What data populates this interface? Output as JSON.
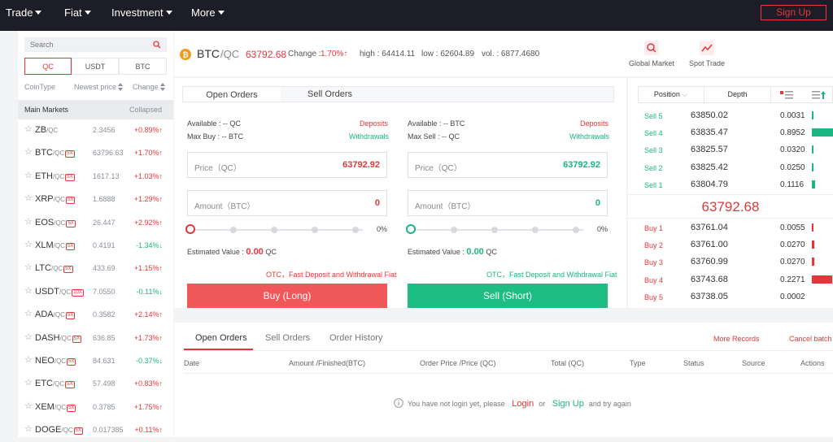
{
  "nav": {
    "items": [
      "Trade",
      "Fiat",
      "Investment",
      "More"
    ],
    "signup": "Sign Up"
  },
  "sidebar": {
    "search_placeholder": "Search",
    "quote_tabs": [
      "QC",
      "USDT",
      "BTC"
    ],
    "columns": {
      "coin": "CoinType",
      "price": "Newest price",
      "change": "Change"
    },
    "markets_label": "Main Markets",
    "collapsed_label": "Collapsed",
    "markets": [
      {
        "coin": "ZB",
        "quote": "/QC",
        "lev": "",
        "price": "2.3456",
        "change": "+0.89%",
        "dir": "up"
      },
      {
        "coin": "BTC",
        "quote": "/QC",
        "lev": "5X",
        "price": "63796.63",
        "change": "+1.70%",
        "dir": "up"
      },
      {
        "coin": "ETH",
        "quote": "/QC",
        "lev": "5X",
        "price": "1617.13",
        "change": "+1.03%",
        "dir": "up"
      },
      {
        "coin": "XRP",
        "quote": "/QC",
        "lev": "5X",
        "price": "1.6888",
        "change": "+1.29%",
        "dir": "up"
      },
      {
        "coin": "EOS",
        "quote": "/QC",
        "lev": "5X",
        "price": "26.447",
        "change": "+2.92%",
        "dir": "up"
      },
      {
        "coin": "XLM",
        "quote": "/QC",
        "lev": "5X",
        "price": "0.4191",
        "change": "-1.34%",
        "dir": "down"
      },
      {
        "coin": "LTC",
        "quote": "/QC",
        "lev": "5X",
        "price": "433.69",
        "change": "+1.15%",
        "dir": "up"
      },
      {
        "coin": "USDT",
        "quote": "/QC",
        "lev": "10X",
        "price": "7.0550",
        "change": "-0.11%",
        "dir": "down"
      },
      {
        "coin": "ADA",
        "quote": "/QC",
        "lev": "5X",
        "price": "0.3582",
        "change": "+2.14%",
        "dir": "up"
      },
      {
        "coin": "DASH",
        "quote": "/QC",
        "lev": "5X",
        "price": "636.85",
        "change": "+1.73%",
        "dir": "up"
      },
      {
        "coin": "NEO",
        "quote": "/QC",
        "lev": "5X",
        "price": "84.631",
        "change": "-0.37%",
        "dir": "down"
      },
      {
        "coin": "ETC",
        "quote": "/QC",
        "lev": "5X",
        "price": "57.498",
        "change": "+0.83%",
        "dir": "up"
      },
      {
        "coin": "XEM",
        "quote": "/QC",
        "lev": "5X",
        "price": "0.3785",
        "change": "+1.75%",
        "dir": "up"
      },
      {
        "coin": "DOGE",
        "quote": "/QC",
        "lev": "5X",
        "price": "0.017385",
        "change": "+0.11%",
        "dir": "up"
      }
    ]
  },
  "header": {
    "coin": "BTC",
    "quote": "/QC",
    "price": "63792.68",
    "change_label": "Change :",
    "change_value": "1.70%",
    "high": "high : 64414.11",
    "low": "low : 62604.89",
    "vol": "vol. : 6877.4680",
    "global_market": "Global Market",
    "spot_trade": "Spot Trade"
  },
  "trade": {
    "tabs": [
      "Open Orders",
      "Sell Orders"
    ],
    "buy": {
      "available": "Available :  -- QC",
      "max": "Max Buy :  -- BTC",
      "price_label": "Price（QC）",
      "price_value": "63792.92",
      "amount_label": "Amount（BTC）",
      "amount_value": "0",
      "pct": "0%",
      "slider_fraction": 0,
      "est_label": "Estimated Value :",
      "est_value": "0.00",
      "est_unit": "QC",
      "otc": "OTC，Fast Deposit and Withdrawal Fiat",
      "button": "Buy (Long)"
    },
    "sell": {
      "available": "Available :  -- BTC",
      "max": "Max Sell :  -- QC",
      "price_label": "Price（QC）",
      "price_value": "63792.92",
      "amount_label": "Amount（BTC）",
      "amount_value": "0",
      "pct": "0%",
      "slider_fraction": 0,
      "est_label": "Estimated Value :",
      "est_value": "0.00",
      "est_unit": "QC",
      "otc": "OTC，Fast Deposit and Withdrawal Fiat",
      "button": "Sell (Short)"
    },
    "deposits": "Deposits",
    "withdrawals": "Withdrawals"
  },
  "book": {
    "position_label": "Position",
    "depth_label": "Depth",
    "sells": [
      {
        "side": "Sell 5",
        "price": "63850.02",
        "qty": "0.0031",
        "fill": 0.01
      },
      {
        "side": "Sell 4",
        "price": "63835.47",
        "qty": "0.8952",
        "fill": 1.0
      },
      {
        "side": "Sell 3",
        "price": "63825.57",
        "qty": "0.0320",
        "fill": 0.04
      },
      {
        "side": "Sell 2",
        "price": "63825.42",
        "qty": "0.0250",
        "fill": 0.03
      },
      {
        "side": "Sell 1",
        "price": "63804.79",
        "qty": "0.1116",
        "fill": 0.12
      }
    ],
    "last_price": "63792.68",
    "buys": [
      {
        "side": "Buy 1",
        "price": "63761.04",
        "qty": "0.0055",
        "fill": 0.02
      },
      {
        "side": "Buy 2",
        "price": "63761.00",
        "qty": "0.0270",
        "fill": 0.1
      },
      {
        "side": "Buy 3",
        "price": "63760.99",
        "qty": "0.0270",
        "fill": 0.1
      },
      {
        "side": "Buy 4",
        "price": "63743.68",
        "qty": "0.2271",
        "fill": 0.82
      },
      {
        "side": "Buy 5",
        "price": "63738.05",
        "qty": "0.0002",
        "fill": 0.0
      }
    ]
  },
  "orders": {
    "tabs": [
      "Open Orders",
      "Sell Orders",
      "Order History"
    ],
    "more": "More Records",
    "cancel": "Cancel batch",
    "columns": [
      "Date",
      "Amount /Finished(BTC)",
      "Order Price /Price (QC)",
      "Total (QC)",
      "Type",
      "Status",
      "Source",
      "Actions"
    ],
    "empty_pre": "You have not login yet, please",
    "login": "Login",
    "or": "or",
    "signup": "Sign Up",
    "empty_post": "and try again"
  },
  "colors": {
    "up": "#e3373a",
    "down": "#1ab581",
    "accent": "#e3373a"
  }
}
